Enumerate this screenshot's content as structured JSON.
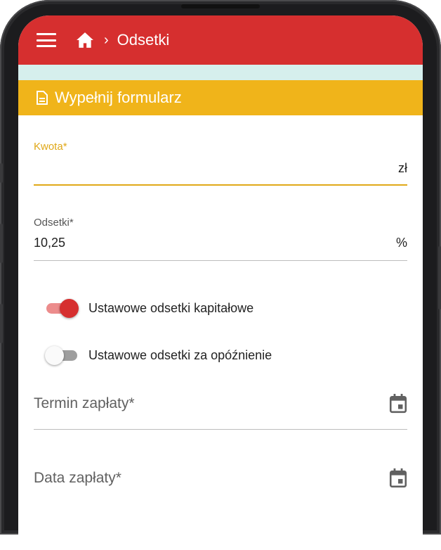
{
  "appbar": {
    "breadcrumb_separator": "›",
    "title": "Odsetki"
  },
  "form": {
    "header": "Wypełnij formularz",
    "amount": {
      "label": "Kwota*",
      "value": "",
      "suffix": "zł"
    },
    "interest": {
      "label": "Odsetki*",
      "value": "10,25",
      "suffix": "%"
    },
    "toggles": [
      {
        "label": "Ustawowe odsetki kapitałowe",
        "on": true
      },
      {
        "label": "Ustawowe odsetki za opóźnienie",
        "on": false
      }
    ],
    "due_date": {
      "placeholder": "Termin zapłaty*"
    },
    "payment_date": {
      "placeholder": "Data zapłaty*"
    }
  },
  "colors": {
    "appbar": "#d62f2f",
    "form_header": "#f0b41a",
    "accent": "#e0a818",
    "strip": "#d6efed"
  },
  "icons": [
    "menu-icon",
    "home-icon",
    "document-icon",
    "calendar-icon"
  ]
}
